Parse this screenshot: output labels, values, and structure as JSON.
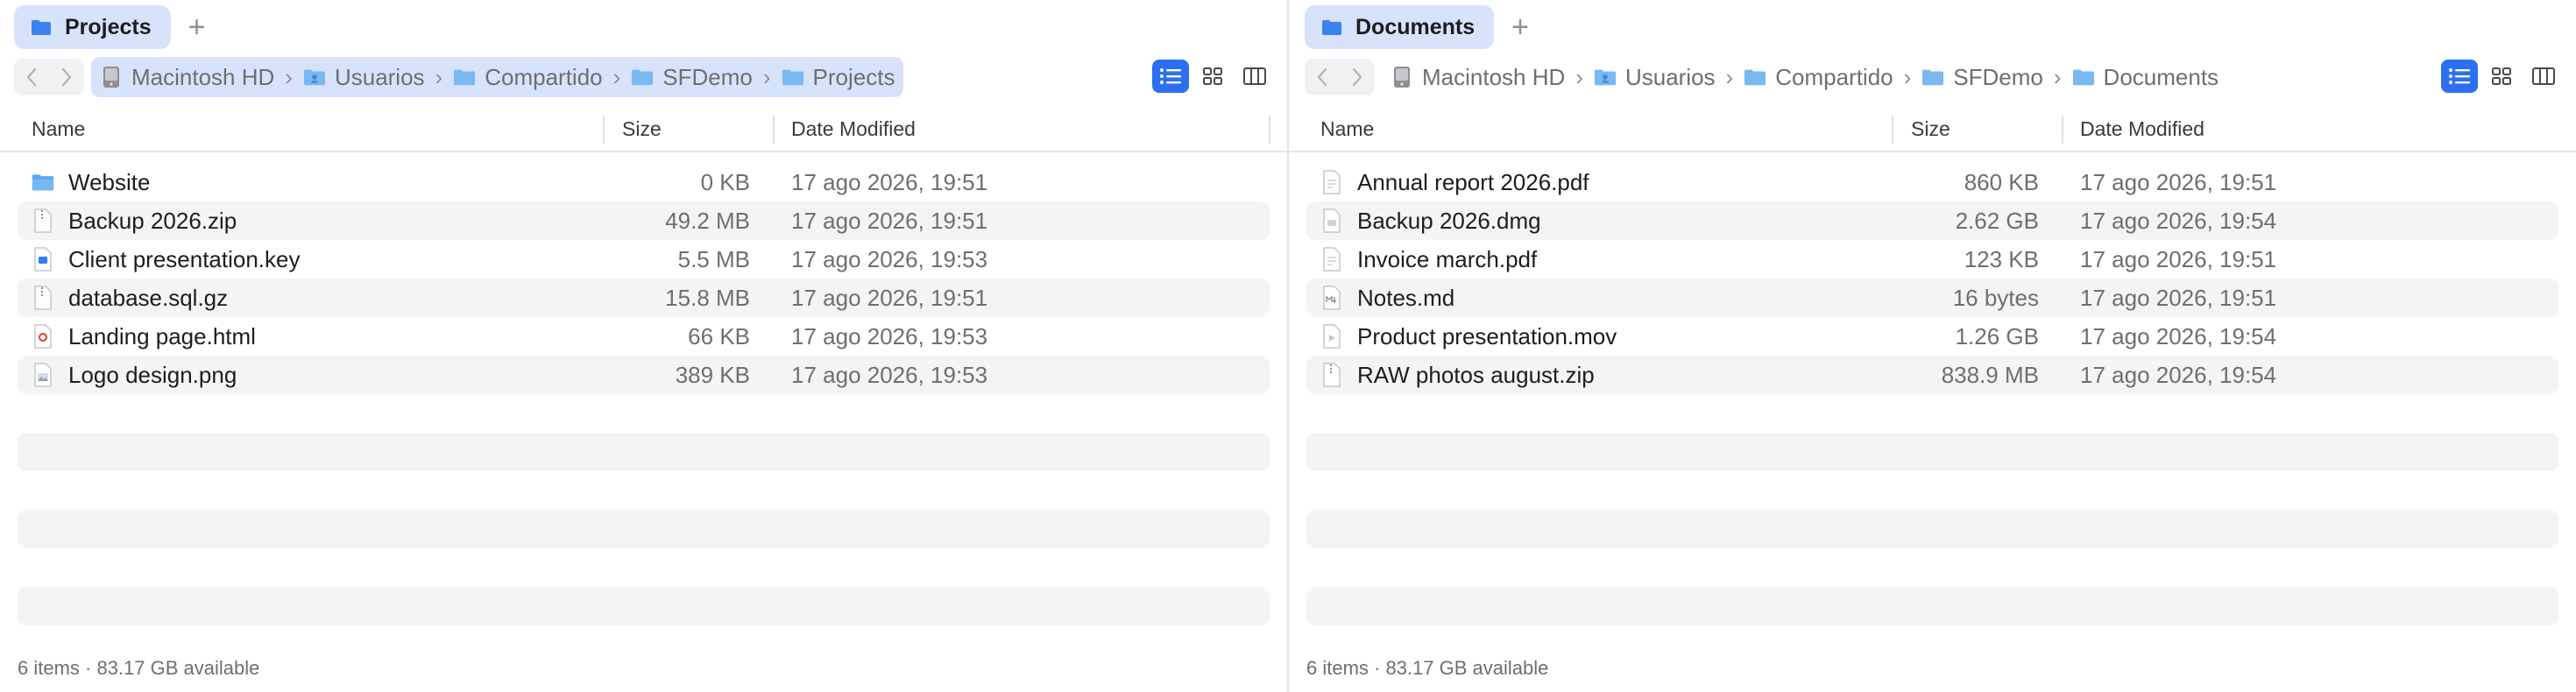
{
  "left": {
    "tab_label": "Projects",
    "add_tab": "+",
    "breadcrumb": [
      "Macintosh HD",
      "Usuarios",
      "Compartido",
      "SFDemo",
      "Projects"
    ],
    "columns": {
      "name": "Name",
      "size": "Size",
      "date": "Date Modified"
    },
    "files": [
      {
        "name": "Website",
        "size": "0 KB",
        "date": "17 ago 2026, 19:51",
        "icon": "folder-icon"
      },
      {
        "name": "Backup 2026.zip",
        "size": "49.2 MB",
        "date": "17 ago 2026, 19:51",
        "icon": "zip-file-icon"
      },
      {
        "name": "Client presentation.key",
        "size": "5.5 MB",
        "date": "17 ago 2026, 19:53",
        "icon": "keynote-file-icon"
      },
      {
        "name": "database.sql.gz",
        "size": "15.8 MB",
        "date": "17 ago 2026, 19:51",
        "icon": "archive-file-icon"
      },
      {
        "name": "Landing page.html",
        "size": "66 KB",
        "date": "17 ago 2026, 19:53",
        "icon": "html-file-icon"
      },
      {
        "name": "Logo design.png",
        "size": "389 KB",
        "date": "17 ago 2026, 19:53",
        "icon": "image-file-icon"
      }
    ],
    "status": "6 items · 83.17 GB available"
  },
  "right": {
    "tab_label": "Documents",
    "add_tab": "+",
    "breadcrumb": [
      "Macintosh HD",
      "Usuarios",
      "Compartido",
      "SFDemo",
      "Documents"
    ],
    "columns": {
      "name": "Name",
      "size": "Size",
      "date": "Date Modified"
    },
    "files": [
      {
        "name": "Annual report 2026.pdf",
        "size": "860 KB",
        "date": "17 ago 2026, 19:51",
        "icon": "pdf-file-icon"
      },
      {
        "name": "Backup 2026.dmg",
        "size": "2.62 GB",
        "date": "17 ago 2026, 19:54",
        "icon": "disk-image-file-icon"
      },
      {
        "name": "Invoice march.pdf",
        "size": "123 KB",
        "date": "17 ago 2026, 19:51",
        "icon": "pdf-file-icon"
      },
      {
        "name": "Notes.md",
        "size": "16 bytes",
        "date": "17 ago 2026, 19:51",
        "icon": "markdown-file-icon"
      },
      {
        "name": "Product presentation.mov",
        "size": "1.26 GB",
        "date": "17 ago 2026, 19:54",
        "icon": "video-file-icon"
      },
      {
        "name": "RAW photos august.zip",
        "size": "838.9 MB",
        "date": "17 ago 2026, 19:54",
        "icon": "zip-file-icon"
      }
    ],
    "status": "6 items · 83.17 GB available"
  },
  "colors": {
    "accent": "#2d6ff1",
    "tab_bg": "#d7e3fb",
    "folder": "#5aa8f0",
    "row_alt": "#f4f4f5"
  }
}
